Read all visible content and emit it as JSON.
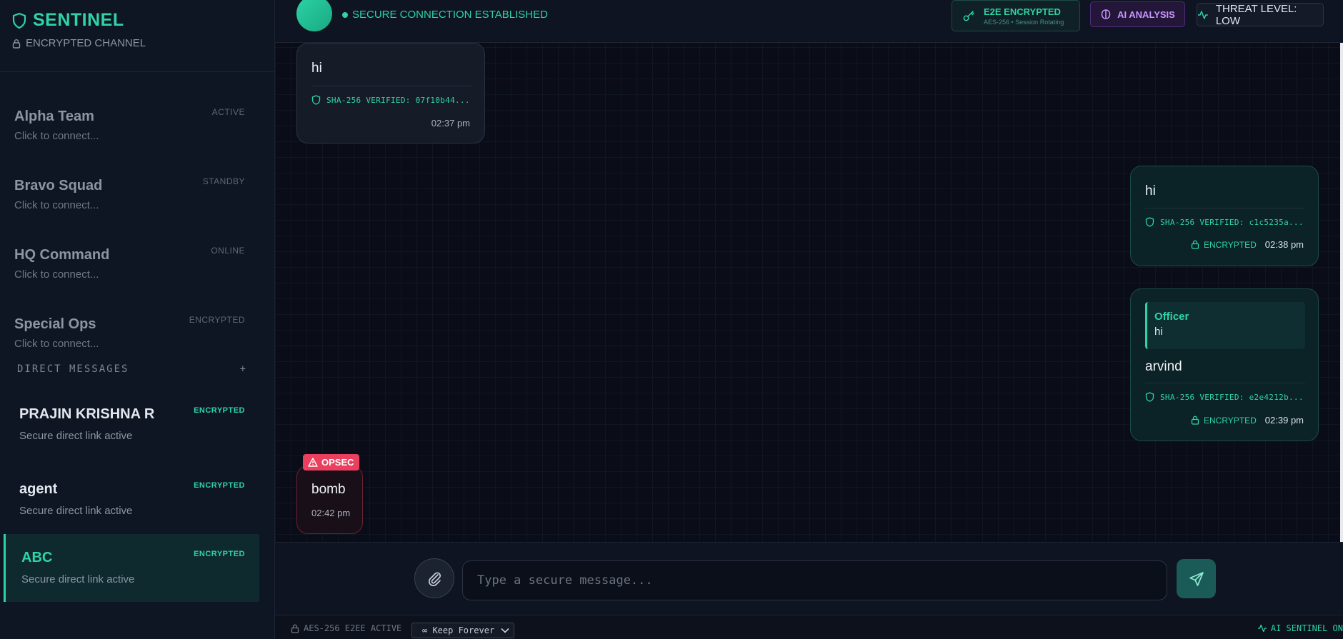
{
  "sidebar": {
    "brand": {
      "title": "SENTINEL",
      "subtitle": "ENCRYPTED CHANNEL"
    },
    "channels": [
      {
        "name": "Alpha Team",
        "status": "ACTIVE",
        "sub": "Click to connect..."
      },
      {
        "name": "Bravo Squad",
        "status": "STANDBY",
        "sub": "Click to connect..."
      },
      {
        "name": "HQ Command",
        "status": "ONLINE",
        "sub": "Click to connect..."
      },
      {
        "name": "Special Ops",
        "status": "ENCRYPTED",
        "sub": "Click to connect..."
      }
    ],
    "dm_header": {
      "label": "DIRECT MESSAGES",
      "add": "+"
    },
    "dms": [
      {
        "name": "PRAJIN KRISHNA R",
        "status": "ENCRYPTED",
        "sub": "Secure direct link active"
      },
      {
        "name": "agent",
        "status": "ENCRYPTED",
        "sub": "Secure direct link active"
      },
      {
        "name": "ABC",
        "status": "ENCRYPTED",
        "sub": "Secure direct link active"
      }
    ]
  },
  "topbar": {
    "connection": "SECURE CONNECTION ESTABLISHED",
    "e2e_title": "E2E ENCRYPTED",
    "e2e_sub": "AES-256 • Session Rotating",
    "ai_label": "AI ANALYSIS",
    "threat_label": "THREAT LEVEL: LOW"
  },
  "messages": [
    {
      "text": "hi",
      "hash": "SHA-256 VERIFIED: 07f10b44...",
      "time": "02:37 pm"
    },
    {
      "text": "hi",
      "hash": "SHA-256 VERIFIED: c1c5235a...",
      "enc": "ENCRYPTED",
      "time": "02:38 pm"
    },
    {
      "quote_name": "Officer",
      "quote_text": "hi",
      "text": "arvind",
      "hash": "SHA-256 VERIFIED: e2e4212b...",
      "enc": "ENCRYPTED",
      "time": "02:39 pm"
    },
    {
      "badge": "OPSEC",
      "text": "bomb",
      "time": "02:42 pm"
    }
  ],
  "composer": {
    "placeholder": "Type a secure message..."
  },
  "footer": {
    "encryption_status": "AES-256 E2EE ACTIVE",
    "retention": "∞ Keep Forever",
    "ai_status": "AI SENTINEL ON"
  },
  "colors": {
    "accent": "#2ed3a6",
    "danger": "#ea3f5f",
    "ai": "#c895ff"
  }
}
